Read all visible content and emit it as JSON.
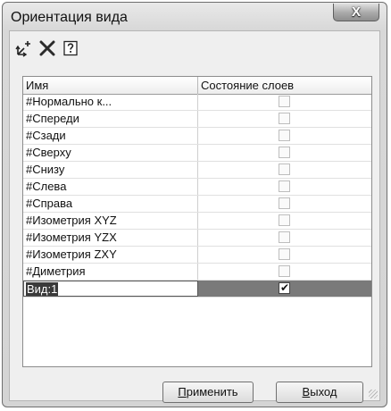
{
  "window": {
    "title": "Ориентация вида",
    "close_label": "X"
  },
  "toolbar": {
    "items": [
      {
        "icon": "add-view-icon",
        "glyph": "⤢"
      },
      {
        "icon": "delete-icon",
        "glyph": "✕"
      },
      {
        "icon": "help-icon",
        "glyph": "?"
      }
    ]
  },
  "grid": {
    "columns": [
      "Имя",
      "Состояние слоев"
    ],
    "rows": [
      {
        "name": "#Нормально к...",
        "checked": false
      },
      {
        "name": "#Спереди",
        "checked": false
      },
      {
        "name": "#Сзади",
        "checked": false
      },
      {
        "name": "#Сверху",
        "checked": false
      },
      {
        "name": "#Снизу",
        "checked": false
      },
      {
        "name": "#Слева",
        "checked": false
      },
      {
        "name": "#Справа",
        "checked": false
      },
      {
        "name": "#Изометрия XYZ",
        "checked": false
      },
      {
        "name": "#Изометрия YZX",
        "checked": false
      },
      {
        "name": "#Изометрия ZXY",
        "checked": false
      },
      {
        "name": "#Диметрия",
        "checked": false
      },
      {
        "name": "Вид:1",
        "checked": true,
        "selected": true
      }
    ]
  },
  "buttons": {
    "apply_prefix": "П",
    "apply_rest": "рименить",
    "exit_prefix": "В",
    "exit_rest": "ыход"
  }
}
